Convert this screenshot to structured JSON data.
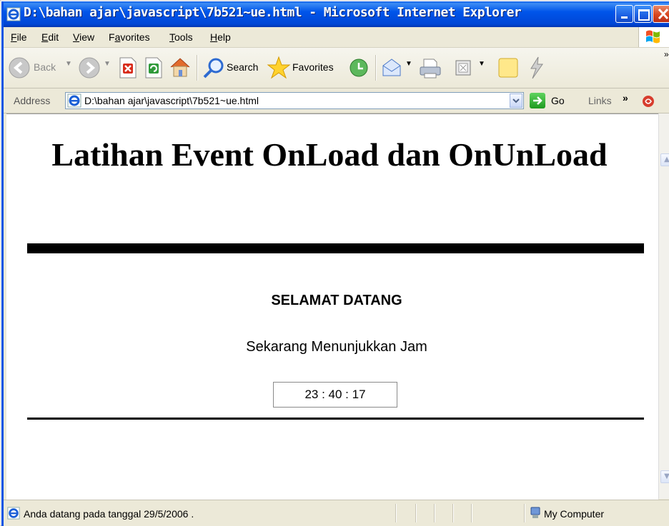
{
  "window": {
    "title": "D:\\bahan ajar\\javascript\\7b521~ue.html - Microsoft Internet Explorer"
  },
  "menu": {
    "items": [
      {
        "label": "File",
        "accel_index": 0
      },
      {
        "label": "Edit",
        "accel_index": 0
      },
      {
        "label": "View",
        "accel_index": 0
      },
      {
        "label": "Favorites",
        "accel_index": 1
      },
      {
        "label": "Tools",
        "accel_index": 0
      },
      {
        "label": "Help",
        "accel_index": 0
      }
    ]
  },
  "toolbar": {
    "back_label": "Back",
    "search_label": "Search",
    "favorites_label": "Favorites",
    "overflow_glyph": "»"
  },
  "address": {
    "label": "Address",
    "value": "D:\\bahan ajar\\javascript\\7b521~ue.html",
    "go_label": "Go",
    "links_label": "Links",
    "links_chevron": "»"
  },
  "page": {
    "heading": "Latihan Event OnLoad dan OnUnLoad",
    "welcome": "SELAMAT DATANG",
    "clock_caption": "Sekarang Menunjukkan Jam",
    "clock_value": "23 : 40 : 17"
  },
  "status": {
    "text": "Anda datang pada tanggal 29/5/2006 .",
    "zone": "My Computer"
  },
  "colors": {
    "titlebar": "#0055ea",
    "chrome": "#ece9d8",
    "content_bg": "#ffffff",
    "rule": "#000000"
  }
}
